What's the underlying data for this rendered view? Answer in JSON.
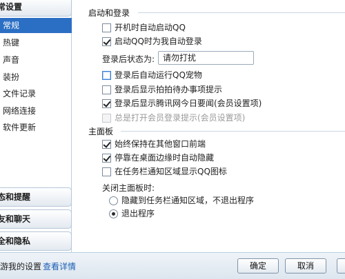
{
  "sidebar": {
    "top_category": "常设置",
    "items": [
      {
        "label": "常规",
        "selected": true
      },
      {
        "label": "热键",
        "selected": false
      },
      {
        "label": "声音",
        "selected": false
      },
      {
        "label": "装扮",
        "selected": false
      },
      {
        "label": "文件记录",
        "selected": false
      },
      {
        "label": "网络连接",
        "selected": false
      },
      {
        "label": "软件更新",
        "selected": false
      }
    ],
    "categories": [
      "态和提醒",
      "友和聊天",
      "全和隐私"
    ]
  },
  "login": {
    "title": "启动和登录",
    "auto_start": "开机时自动启动QQ",
    "auto_login": "启动QQ时为我自动登录",
    "status_label": "登录后状态为:",
    "status_value": "请勿打扰",
    "auto_pet": "登录后自动运行QQ宠物",
    "show_memo": "登录后显示拍拍待办事项提示",
    "show_news": "登录后显示腾讯网今日要闻(会员设置项)",
    "open_member": "总是打开会员登录提示(会员设置项)"
  },
  "main_panel": {
    "title": "主面板",
    "always_top": "始终保持在其他窗口前端",
    "auto_hide": "停靠在桌面边缘时自动隐藏",
    "tray_icon": "在任务栏通知区域显示QQ图标",
    "close_label": "关闭主面板时:",
    "close_hide": "隐藏到任务栏通知区域，不退出程序",
    "close_exit": "退出程序"
  },
  "bottom": {
    "roam_label": "游我的设置",
    "roam_link": "查看详情",
    "ok": "确定",
    "cancel": "取消",
    "apply": ""
  }
}
